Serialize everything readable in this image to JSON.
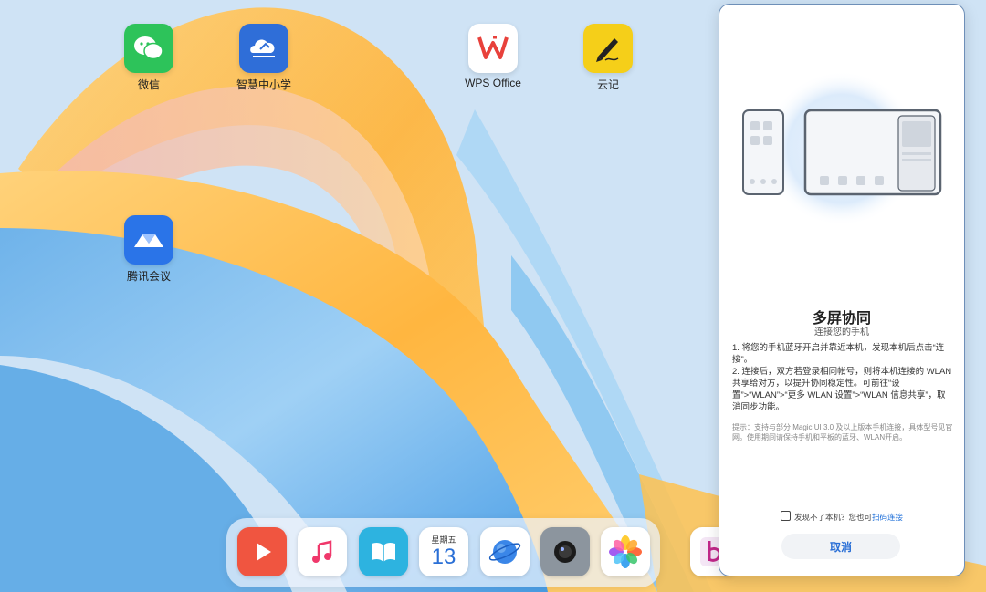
{
  "desktop": {
    "apps": [
      {
        "label": "微信",
        "icon": "wechat-icon",
        "color": "#2dc35a"
      },
      {
        "label": "智慧中小学",
        "icon": "smart-school-icon",
        "color": "#2f6ed8"
      },
      {
        "label": "WPS Office",
        "icon": "wps-icon",
        "color": "#e8413b"
      },
      {
        "label": "云记",
        "icon": "cloud-note-icon",
        "color": "#f5cf19"
      },
      {
        "label": "腾讯会议",
        "icon": "tencent-meeting-icon",
        "color": "#2a74e8"
      }
    ]
  },
  "dock": {
    "apps": [
      {
        "icon": "video-player-icon",
        "color": "#f05540"
      },
      {
        "icon": "music-icon",
        "color": "#ffffff"
      },
      {
        "icon": "books-icon",
        "color": "#2db3e0"
      },
      {
        "icon": "calendar-icon",
        "weekday": "星期五",
        "day": "13"
      },
      {
        "icon": "browser-icon",
        "color": "#ffffff"
      },
      {
        "icon": "camera-icon",
        "color": "#8c959e"
      },
      {
        "icon": "gallery-icon",
        "color": "#ffffff"
      }
    ],
    "extra_app_icon": "education-app-icon"
  },
  "panel": {
    "title": "多屏协同",
    "subtitle": "连接您的手机",
    "step1": "1. 将您的手机蓝牙开启并靠近本机，发现本机后点击“连接”。",
    "step2": "2. 连接后，双方若登录相同帐号，则将本机连接的 WLAN 共享给对方，以提升协同稳定性。可前往“设置”>“WLAN”>“更多 WLAN 设置”>“WLAN 信息共享”，取消同步功能。",
    "hint": "提示：支持与部分 Magic UI 3.0 及以上版本手机连接，具体型号见官网。使用期间请保持手机和平板的蓝牙、WLAN开启。",
    "not_found": "发现不了本机？您也可",
    "scan_link": "扫码连接",
    "cancel": "取消"
  }
}
